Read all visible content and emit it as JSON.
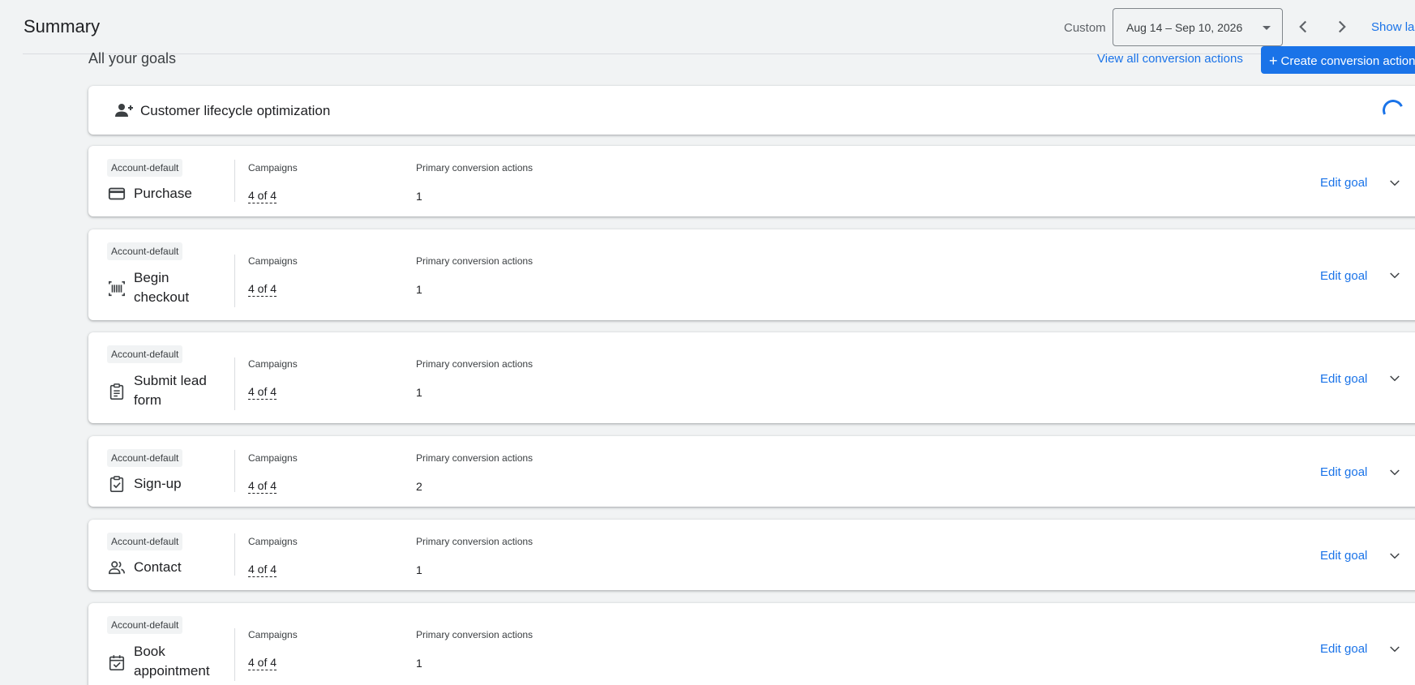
{
  "header": {
    "title": "Summary",
    "date_range_label": "Custom",
    "date_range_value": "Aug 14 – Sep 10, 2026",
    "show_last_label": "Show last"
  },
  "section": {
    "title": "All your goals",
    "view_all_label": "View all conversion actions",
    "create_label": "Create conversion action"
  },
  "lifecycle": {
    "title": "Customer lifecycle optimization",
    "icon": "person-add-icon"
  },
  "columns": {
    "campaigns": "Campaigns",
    "primary_actions": "Primary conversion actions"
  },
  "goals": [
    {
      "badge": "Account-default",
      "name_lines": [
        "Purchase"
      ],
      "icon": "credit-card-icon",
      "campaigns": "4 of 4",
      "primary_actions": "1",
      "edit_label": "Edit goal"
    },
    {
      "badge": "Account-default",
      "name_lines": [
        "Begin",
        "checkout"
      ],
      "icon": "barcode-icon",
      "campaigns": "4 of 4",
      "primary_actions": "1",
      "edit_label": "Edit goal"
    },
    {
      "badge": "Account-default",
      "name_lines": [
        "Submit lead",
        "form"
      ],
      "icon": "clipboard-icon",
      "campaigns": "4 of 4",
      "primary_actions": "1",
      "edit_label": "Edit goal"
    },
    {
      "badge": "Account-default",
      "name_lines": [
        "Sign-up"
      ],
      "icon": "checked-box-icon",
      "campaigns": "4 of 4",
      "primary_actions": "2",
      "edit_label": "Edit goal"
    },
    {
      "badge": "Account-default",
      "name_lines": [
        "Contact"
      ],
      "icon": "people-icon",
      "campaigns": "4 of 4",
      "primary_actions": "1",
      "edit_label": "Edit goal"
    },
    {
      "badge": "Account-default",
      "name_lines": [
        "Book",
        "appointment"
      ],
      "icon": "calendar-check-icon",
      "campaigns": "4 of 4",
      "primary_actions": "1",
      "edit_label": "Edit goal"
    }
  ],
  "colors": {
    "accent": "#1a73e8",
    "background": "#f1f3f4",
    "card": "#ffffff",
    "text": "#202124",
    "muted": "#5f6368"
  }
}
